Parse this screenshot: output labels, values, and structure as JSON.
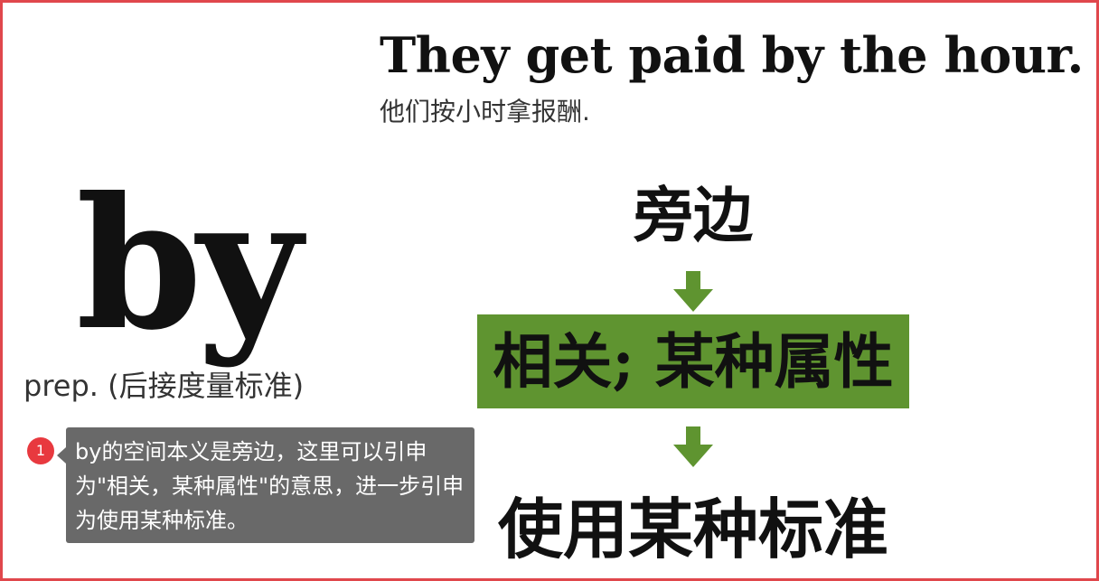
{
  "example": {
    "sentence_en": "They get paid by the hour.",
    "sentence_zh": "他们按小时拿报酬."
  },
  "word": {
    "headword": "by",
    "part_of_speech": "prep. (后接度量标准)"
  },
  "meanings": {
    "step1": "旁边",
    "step2": "相关; 某种属性",
    "step3": "使用某种标准"
  },
  "note": {
    "number": "1",
    "text": "by的空间本义是旁边，这里可以引申为\"相关，某种属性\"的意思，进一步引申为使用某种标准。"
  },
  "colors": {
    "border": "#e0474c",
    "accent_green": "#5f9430",
    "note_bg": "#696969",
    "badge": "#e8393f"
  },
  "icons": [
    "down-arrow-icon",
    "down-arrow-icon"
  ]
}
